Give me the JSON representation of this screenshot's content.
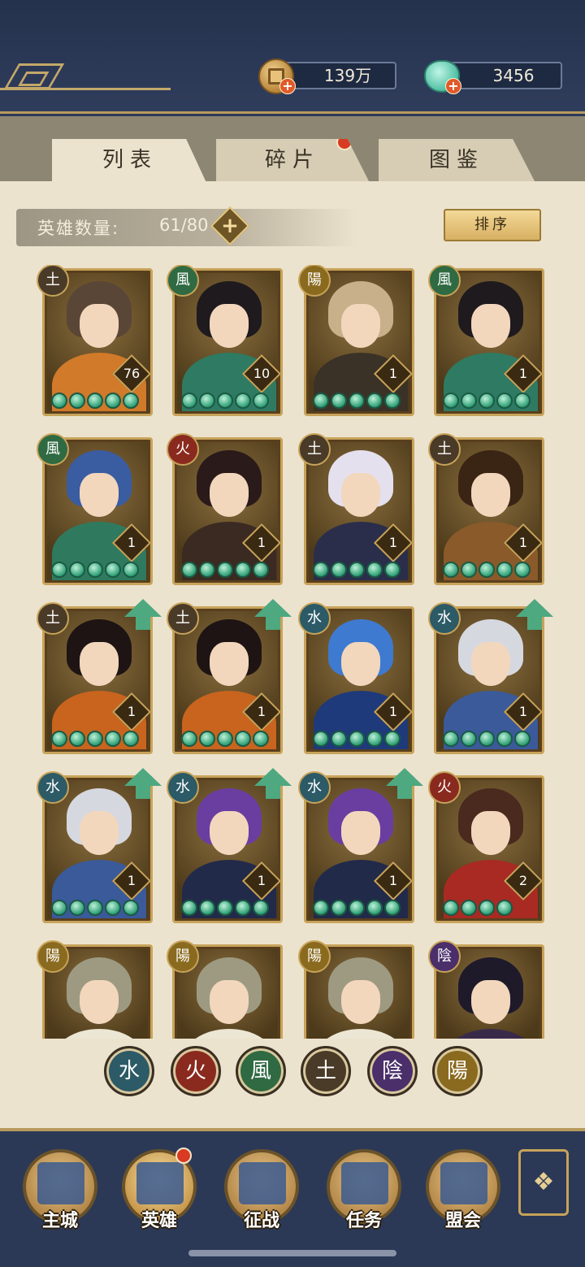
{
  "currency": {
    "coins": "139万",
    "jade": "3456"
  },
  "tabs": [
    {
      "label": "列表",
      "active": true
    },
    {
      "label": "碎片",
      "active": false,
      "notification": true
    },
    {
      "label": "图鉴",
      "active": false
    }
  ],
  "hero_count": {
    "label": "英雄数量:",
    "value": "61/80"
  },
  "sort_label": "排序",
  "colors": {
    "water": "#2c5a66",
    "fire": "#8a2a1e",
    "wind": "#2f6a42",
    "earth": "#4a3b28",
    "yin": "#4a2f6a",
    "yang": "#8a6a1e",
    "star": "#2f9f76",
    "upgrade": "#4ea880"
  },
  "heroes": [
    {
      "element": "土",
      "level": "76",
      "stars": 5,
      "upgrade": false,
      "hair": "#5a4636",
      "body": "#d07a2a"
    },
    {
      "element": "風",
      "level": "10",
      "stars": 5,
      "upgrade": false,
      "hair": "#1e1a1e",
      "body": "#2f7a62"
    },
    {
      "element": "陽",
      "level": "1",
      "stars": 5,
      "upgrade": false,
      "hair": "#c8b08a",
      "body": "#3a3226"
    },
    {
      "element": "風",
      "level": "1",
      "stars": 5,
      "upgrade": false,
      "hair": "#1e1a1e",
      "body": "#2f7a62"
    },
    {
      "element": "風",
      "level": "1",
      "stars": 5,
      "upgrade": false,
      "hair": "#3a5ca0",
      "body": "#2f7a5e"
    },
    {
      "element": "火",
      "level": "1",
      "stars": 5,
      "upgrade": false,
      "hair": "#2a1a1a",
      "body": "#3a2a22"
    },
    {
      "element": "土",
      "level": "1",
      "stars": 5,
      "upgrade": false,
      "hair": "#e4e0ee",
      "body": "#2a2e4a"
    },
    {
      "element": "土",
      "level": "1",
      "stars": 5,
      "upgrade": false,
      "hair": "#3a2414",
      "body": "#8a5a2a"
    },
    {
      "element": "土",
      "level": "1",
      "stars": 5,
      "upgrade": true,
      "hair": "#1e1414",
      "body": "#c8641e"
    },
    {
      "element": "土",
      "level": "1",
      "stars": 5,
      "upgrade": true,
      "hair": "#1e1414",
      "body": "#c8641e"
    },
    {
      "element": "水",
      "level": "1",
      "stars": 5,
      "upgrade": false,
      "hair": "#3e7ad0",
      "body": "#1e3a7a"
    },
    {
      "element": "水",
      "level": "1",
      "stars": 5,
      "upgrade": true,
      "hair": "#d6d8e0",
      "body": "#3a5a9a"
    },
    {
      "element": "水",
      "level": "1",
      "stars": 5,
      "upgrade": true,
      "hair": "#d6d8e0",
      "body": "#3a5a9a"
    },
    {
      "element": "水",
      "level": "1",
      "stars": 5,
      "upgrade": true,
      "hair": "#6a3ea0",
      "body": "#222a4a"
    },
    {
      "element": "水",
      "level": "1",
      "stars": 5,
      "upgrade": true,
      "hair": "#6a3ea0",
      "body": "#222a4a"
    },
    {
      "element": "火",
      "level": "2",
      "stars": 4,
      "upgrade": false,
      "hair": "#4a2a1e",
      "body": "#a82a22"
    },
    {
      "element": "陽",
      "level": "",
      "stars": 0,
      "upgrade": false,
      "hair": "#9e9a82",
      "body": "#ece6d4"
    },
    {
      "element": "陽",
      "level": "",
      "stars": 0,
      "upgrade": false,
      "hair": "#9e9a82",
      "body": "#ece6d4"
    },
    {
      "element": "陽",
      "level": "",
      "stars": 0,
      "upgrade": false,
      "hair": "#9e9a82",
      "body": "#ece6d4"
    },
    {
      "element": "陰",
      "level": "",
      "stars": 0,
      "upgrade": false,
      "hair": "#1e1a2a",
      "body": "#3a2a4a"
    }
  ],
  "filters": [
    "水",
    "火",
    "風",
    "土",
    "陰",
    "陽"
  ],
  "nav": [
    {
      "label": "主城",
      "icon": "castle-icon"
    },
    {
      "label": "英雄",
      "icon": "hero-icon",
      "active": true,
      "notification": true
    },
    {
      "label": "征战",
      "icon": "battle-icon"
    },
    {
      "label": "任务",
      "icon": "quest-icon"
    },
    {
      "label": "盟会",
      "icon": "guild-icon"
    }
  ],
  "more_icon": "more-menu-icon"
}
